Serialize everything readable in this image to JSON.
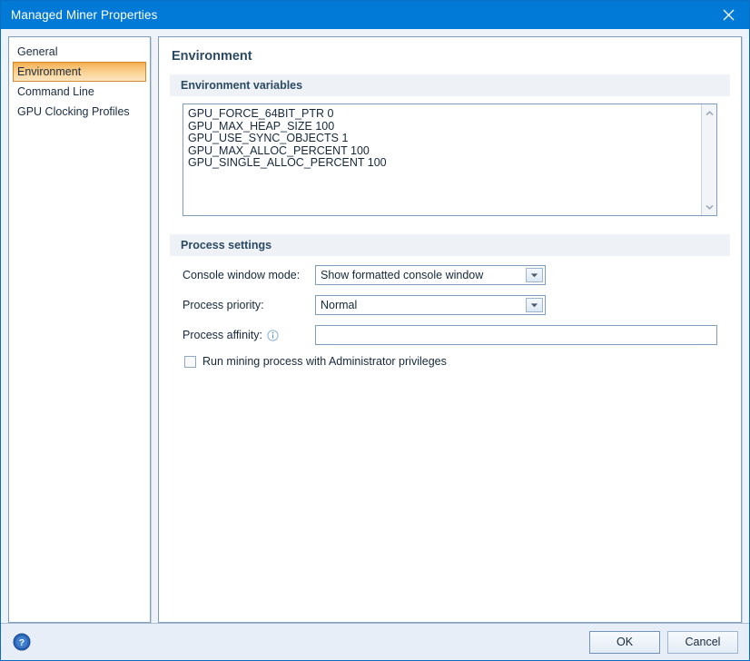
{
  "window": {
    "title": "Managed Miner Properties",
    "close_icon": "close-icon",
    "titlebar_color": "#0079d7"
  },
  "sidebar": {
    "items": [
      {
        "label": "General",
        "selected": false
      },
      {
        "label": "Environment",
        "selected": true
      },
      {
        "label": "Command Line",
        "selected": false
      },
      {
        "label": "GPU Clocking Profiles",
        "selected": false
      }
    ],
    "selected_color": "#f3aa4e"
  },
  "content": {
    "page_title": "Environment",
    "env_group": {
      "header": "Environment variables",
      "value": "GPU_FORCE_64BIT_PTR 0\nGPU_MAX_HEAP_SIZE 100\nGPU_USE_SYNC_OBJECTS 1\nGPU_MAX_ALLOC_PERCENT 100\nGPU_SINGLE_ALLOC_PERCENT 100",
      "scroll_up_icon": "chevron-up-icon",
      "scroll_down_icon": "chevron-down-icon"
    },
    "process_group": {
      "header": "Process settings",
      "console_mode": {
        "label": "Console window mode:",
        "value": "Show formatted console window",
        "dropdown_icon": "chevron-down-icon"
      },
      "priority": {
        "label": "Process priority:",
        "value": "Normal",
        "dropdown_icon": "chevron-down-icon"
      },
      "affinity": {
        "label": "Process affinity:",
        "value": "",
        "placeholder": "",
        "info_icon": "info-icon"
      },
      "admin_checkbox": {
        "label": "Run mining process with Administrator privileges",
        "checked": false
      }
    }
  },
  "footer": {
    "help_icon": "help-icon",
    "ok_label": "OK",
    "cancel_label": "Cancel"
  }
}
